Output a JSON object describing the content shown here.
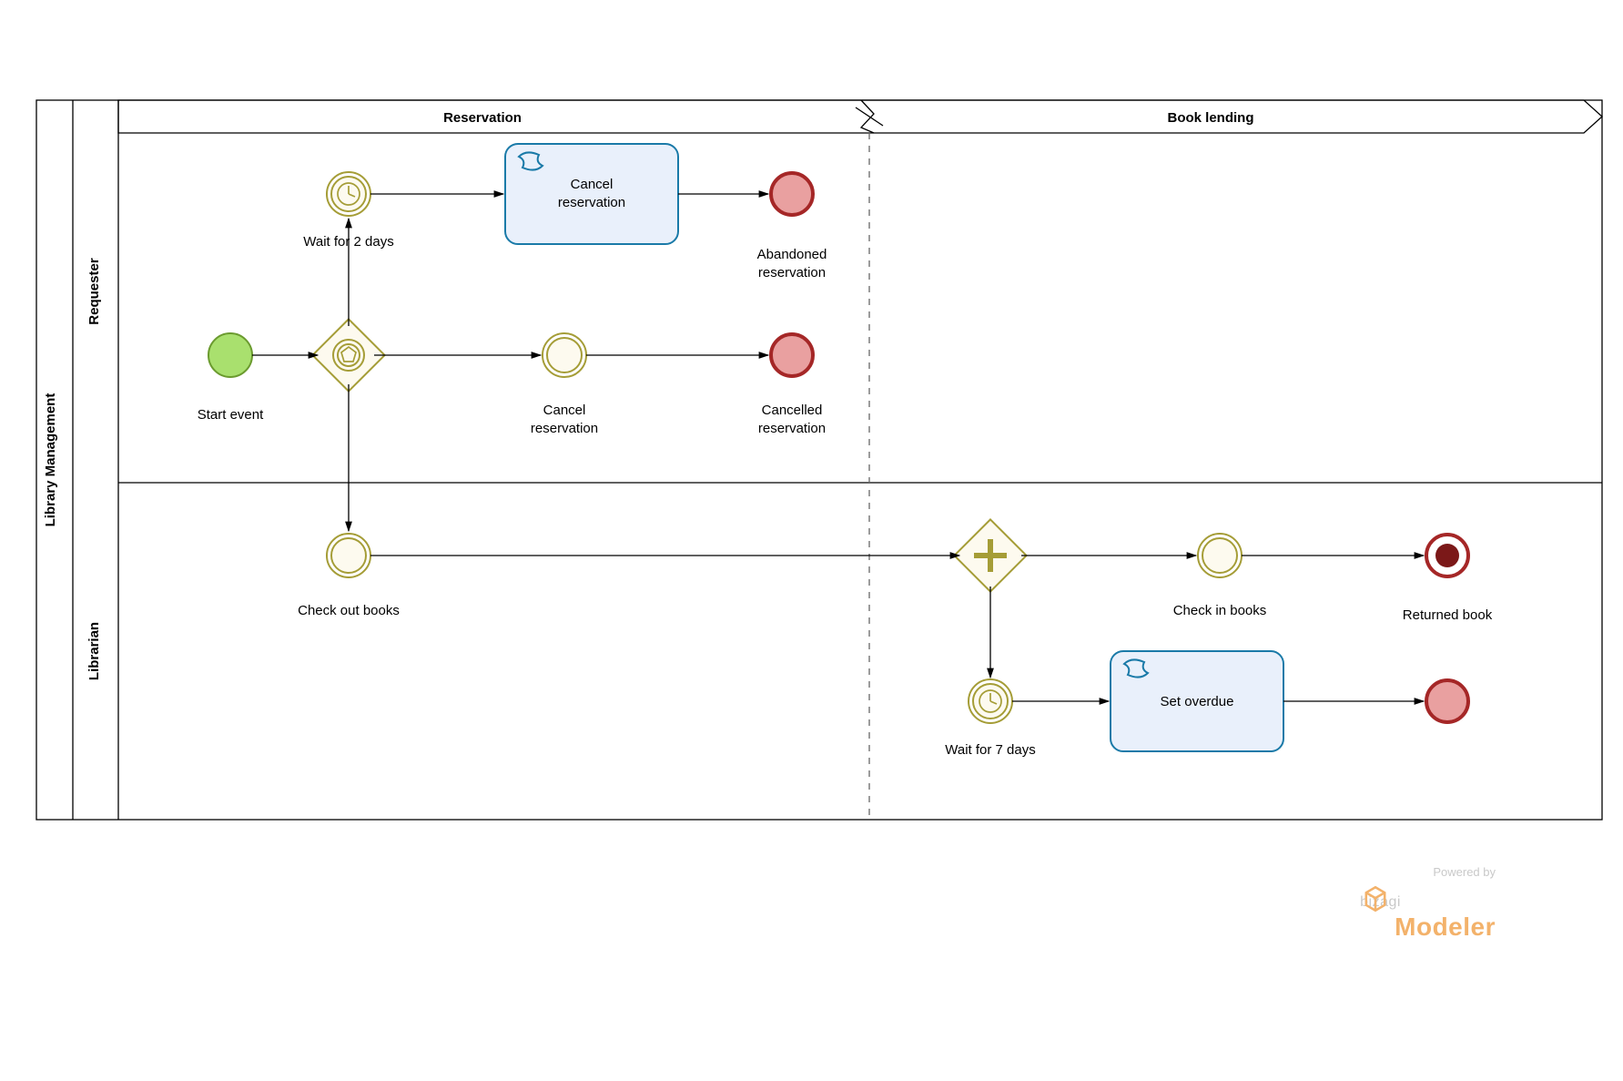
{
  "pool": {
    "title": "Library Management"
  },
  "lanes": {
    "top": "Requester",
    "bottom": "Librarian"
  },
  "phases": {
    "left": "Reservation",
    "right": "Book lending"
  },
  "requester": {
    "start": "Start event",
    "timer": "Wait for 2 days",
    "cancelTask": "Cancel\nreservation",
    "abandoned": "Abandoned\nreservation",
    "cancelEvent": "Cancel\nreservation",
    "cancelled": "Cancelled\nreservation"
  },
  "librarian": {
    "checkout": "Check out books",
    "timer": "Wait for 7 days",
    "overdueTask": "Set overdue",
    "checkin": "Check in books",
    "returned": "Returned book"
  },
  "footer": {
    "powered": "Powered by",
    "brand": "bizagi",
    "product": "Modeler"
  }
}
